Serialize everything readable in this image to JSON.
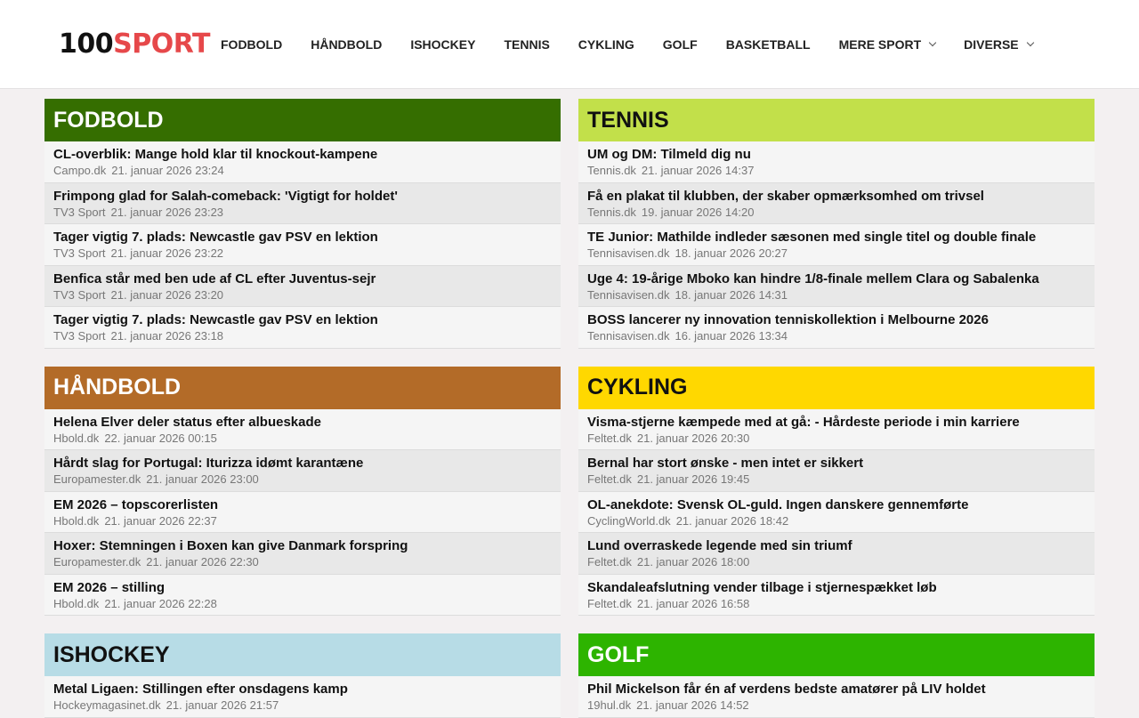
{
  "brand": {
    "num": "100",
    "word": "SPORT"
  },
  "nav": [
    {
      "label": "FODBOLD",
      "dropdown": false
    },
    {
      "label": "HÅNDBOLD",
      "dropdown": false
    },
    {
      "label": "ISHOCKEY",
      "dropdown": false
    },
    {
      "label": "TENNIS",
      "dropdown": false
    },
    {
      "label": "CYKLING",
      "dropdown": false
    },
    {
      "label": "GOLF",
      "dropdown": false
    },
    {
      "label": "BASKETBALL",
      "dropdown": false
    },
    {
      "label": "MERE SPORT",
      "dropdown": true
    },
    {
      "label": "DIVERSE",
      "dropdown": true
    }
  ],
  "sections": [
    {
      "title": "FODBOLD",
      "color": "#356e00",
      "text": "dark",
      "items": [
        {
          "title": "CL-overblik: Mange hold klar til knockout-kampene",
          "source": "Campo.dk",
          "date": "21. januar 2026 23:24"
        },
        {
          "title": "Frimpong glad for Salah-comeback: 'Vigtigt for holdet'",
          "source": "TV3 Sport",
          "date": "21. januar 2026 23:23"
        },
        {
          "title": "Tager vigtig 7. plads: Newcastle gav PSV en lektion",
          "source": "TV3 Sport",
          "date": "21. januar 2026 23:22"
        },
        {
          "title": "Benfica står med ben ude af CL efter Juventus-sejr",
          "source": "TV3 Sport",
          "date": "21. januar 2026 23:20"
        },
        {
          "title": "Tager vigtig 7. plads: Newcastle gav PSV en lektion",
          "source": "TV3 Sport",
          "date": "21. januar 2026 23:18"
        }
      ]
    },
    {
      "title": "TENNIS",
      "color": "#c2e04a",
      "text": "light",
      "items": [
        {
          "title": "UM og DM: Tilmeld dig nu",
          "source": "Tennis.dk",
          "date": "21. januar 2026 14:37"
        },
        {
          "title": "Få en plakat til klubben, der skaber opmærksomhed om trivsel",
          "source": "Tennis.dk",
          "date": "19. januar 2026 14:20"
        },
        {
          "title": "TE Junior: Mathilde indleder sæsonen med single titel og double finale",
          "source": "Tennisavisen.dk",
          "date": "18. januar 2026 20:27"
        },
        {
          "title": "Uge 4: 19-årige Mboko kan hindre 1/8-finale mellem Clara og Sabalenka",
          "source": "Tennisavisen.dk",
          "date": "18. januar 2026 14:31"
        },
        {
          "title": "BOSS lancerer ny innovation tenniskollektion i Melbourne 2026",
          "source": "Tennisavisen.dk",
          "date": "16. januar 2026 13:34"
        }
      ]
    },
    {
      "title": "HÅNDBOLD",
      "color": "#b36b28",
      "text": "dark",
      "items": [
        {
          "title": "Helena Elver deler status efter albueskade",
          "source": "Hbold.dk",
          "date": "22. januar 2026 00:15"
        },
        {
          "title": "Hårdt slag for Portugal: Iturizza idømt karantæne",
          "source": "Europamester.dk",
          "date": "21. januar 2026 23:00"
        },
        {
          "title": "EM 2026 – topscorerlisten",
          "source": "Hbold.dk",
          "date": "21. januar 2026 22:37"
        },
        {
          "title": "Hoxer: Stemningen i Boxen kan give Danmark forspring",
          "source": "Europamester.dk",
          "date": "21. januar 2026 22:30"
        },
        {
          "title": "EM 2026 – stilling",
          "source": "Hbold.dk",
          "date": "21. januar 2026 22:28"
        }
      ]
    },
    {
      "title": "CYKLING",
      "color": "#ffd800",
      "text": "light",
      "items": [
        {
          "title": "Visma-stjerne kæmpede med at gå: - Hårdeste periode i min karriere",
          "source": "Feltet.dk",
          "date": "21. januar 2026 20:30"
        },
        {
          "title": "Bernal har stort ønske - men intet er sikkert",
          "source": "Feltet.dk",
          "date": "21. januar 2026 19:45"
        },
        {
          "title": "OL-anekdote: Svensk OL-guld. Ingen danskere gennemførte",
          "source": "CyclingWorld.dk",
          "date": "21. januar 2026 18:42"
        },
        {
          "title": "Lund overraskede legende med sin triumf",
          "source": "Feltet.dk",
          "date": "21. januar 2026 18:00"
        },
        {
          "title": "Skandaleafslutning vender tilbage i stjernespækket løb",
          "source": "Feltet.dk",
          "date": "21. januar 2026 16:58"
        }
      ]
    },
    {
      "title": "ISHOCKEY",
      "color": "#b7dce6",
      "text": "light",
      "items": [
        {
          "title": "Metal Ligaen: Stillingen efter onsdagens kamp",
          "source": "Hockeymagasinet.dk",
          "date": "21. januar 2026 21:57"
        }
      ]
    },
    {
      "title": "GOLF",
      "color": "#2db400",
      "text": "dark",
      "items": [
        {
          "title": "Phil Mickelson får én af verdens bedste amatører på LIV holdet",
          "source": "19hul.dk",
          "date": "21. januar 2026 14:52"
        }
      ]
    }
  ]
}
